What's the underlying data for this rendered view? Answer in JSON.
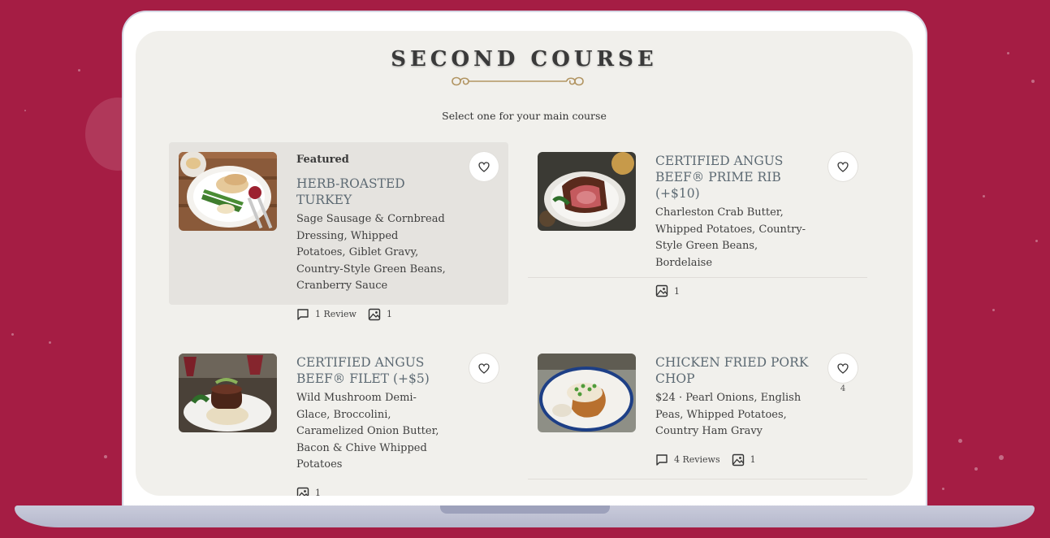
{
  "page": {
    "title": "SECOND COURSE",
    "subtitle": "Select one for your main course"
  },
  "colors": {
    "background": "#a51d44",
    "screen": "#f1f0ec",
    "featured_card": "#e5e3df",
    "dish_name": "#5d6a73",
    "ornament": "#b29563"
  },
  "icons": {
    "heart": "heart-icon",
    "review": "speech-bubble-icon",
    "photo": "image-icon"
  },
  "dishes": [
    {
      "featured_label": "Featured",
      "name": "HERB-ROASTED TURKEY",
      "description": "Sage Sausage & Cornbread Dressing, Whipped Potatoes, Giblet Gravy, Country-Style Green Beans, Cranberry Sauce",
      "reviews": "1 Review",
      "photos": "1"
    },
    {
      "name": "CERTIFIED ANGUS BEEF® PRIME RIB (+$10)",
      "description": "Charleston Crab Butter, Whipped Potatoes, Country-Style Green Beans, Bordelaise",
      "photos": "1"
    },
    {
      "name": "CERTIFIED ANGUS BEEF® FILET (+$5)",
      "description": "Wild Mushroom Demi-Glace, Broccolini, Caramelized Onion Butter, Bacon & Chive Whipped Potatoes",
      "photos": "1"
    },
    {
      "name": "CHICKEN FRIED PORK CHOP",
      "description": "$24 · Pearl Onions, English Peas, Whipped Potatoes, Country Ham Gravy",
      "reviews": "4 Reviews",
      "photos": "1",
      "likes": "4"
    }
  ]
}
